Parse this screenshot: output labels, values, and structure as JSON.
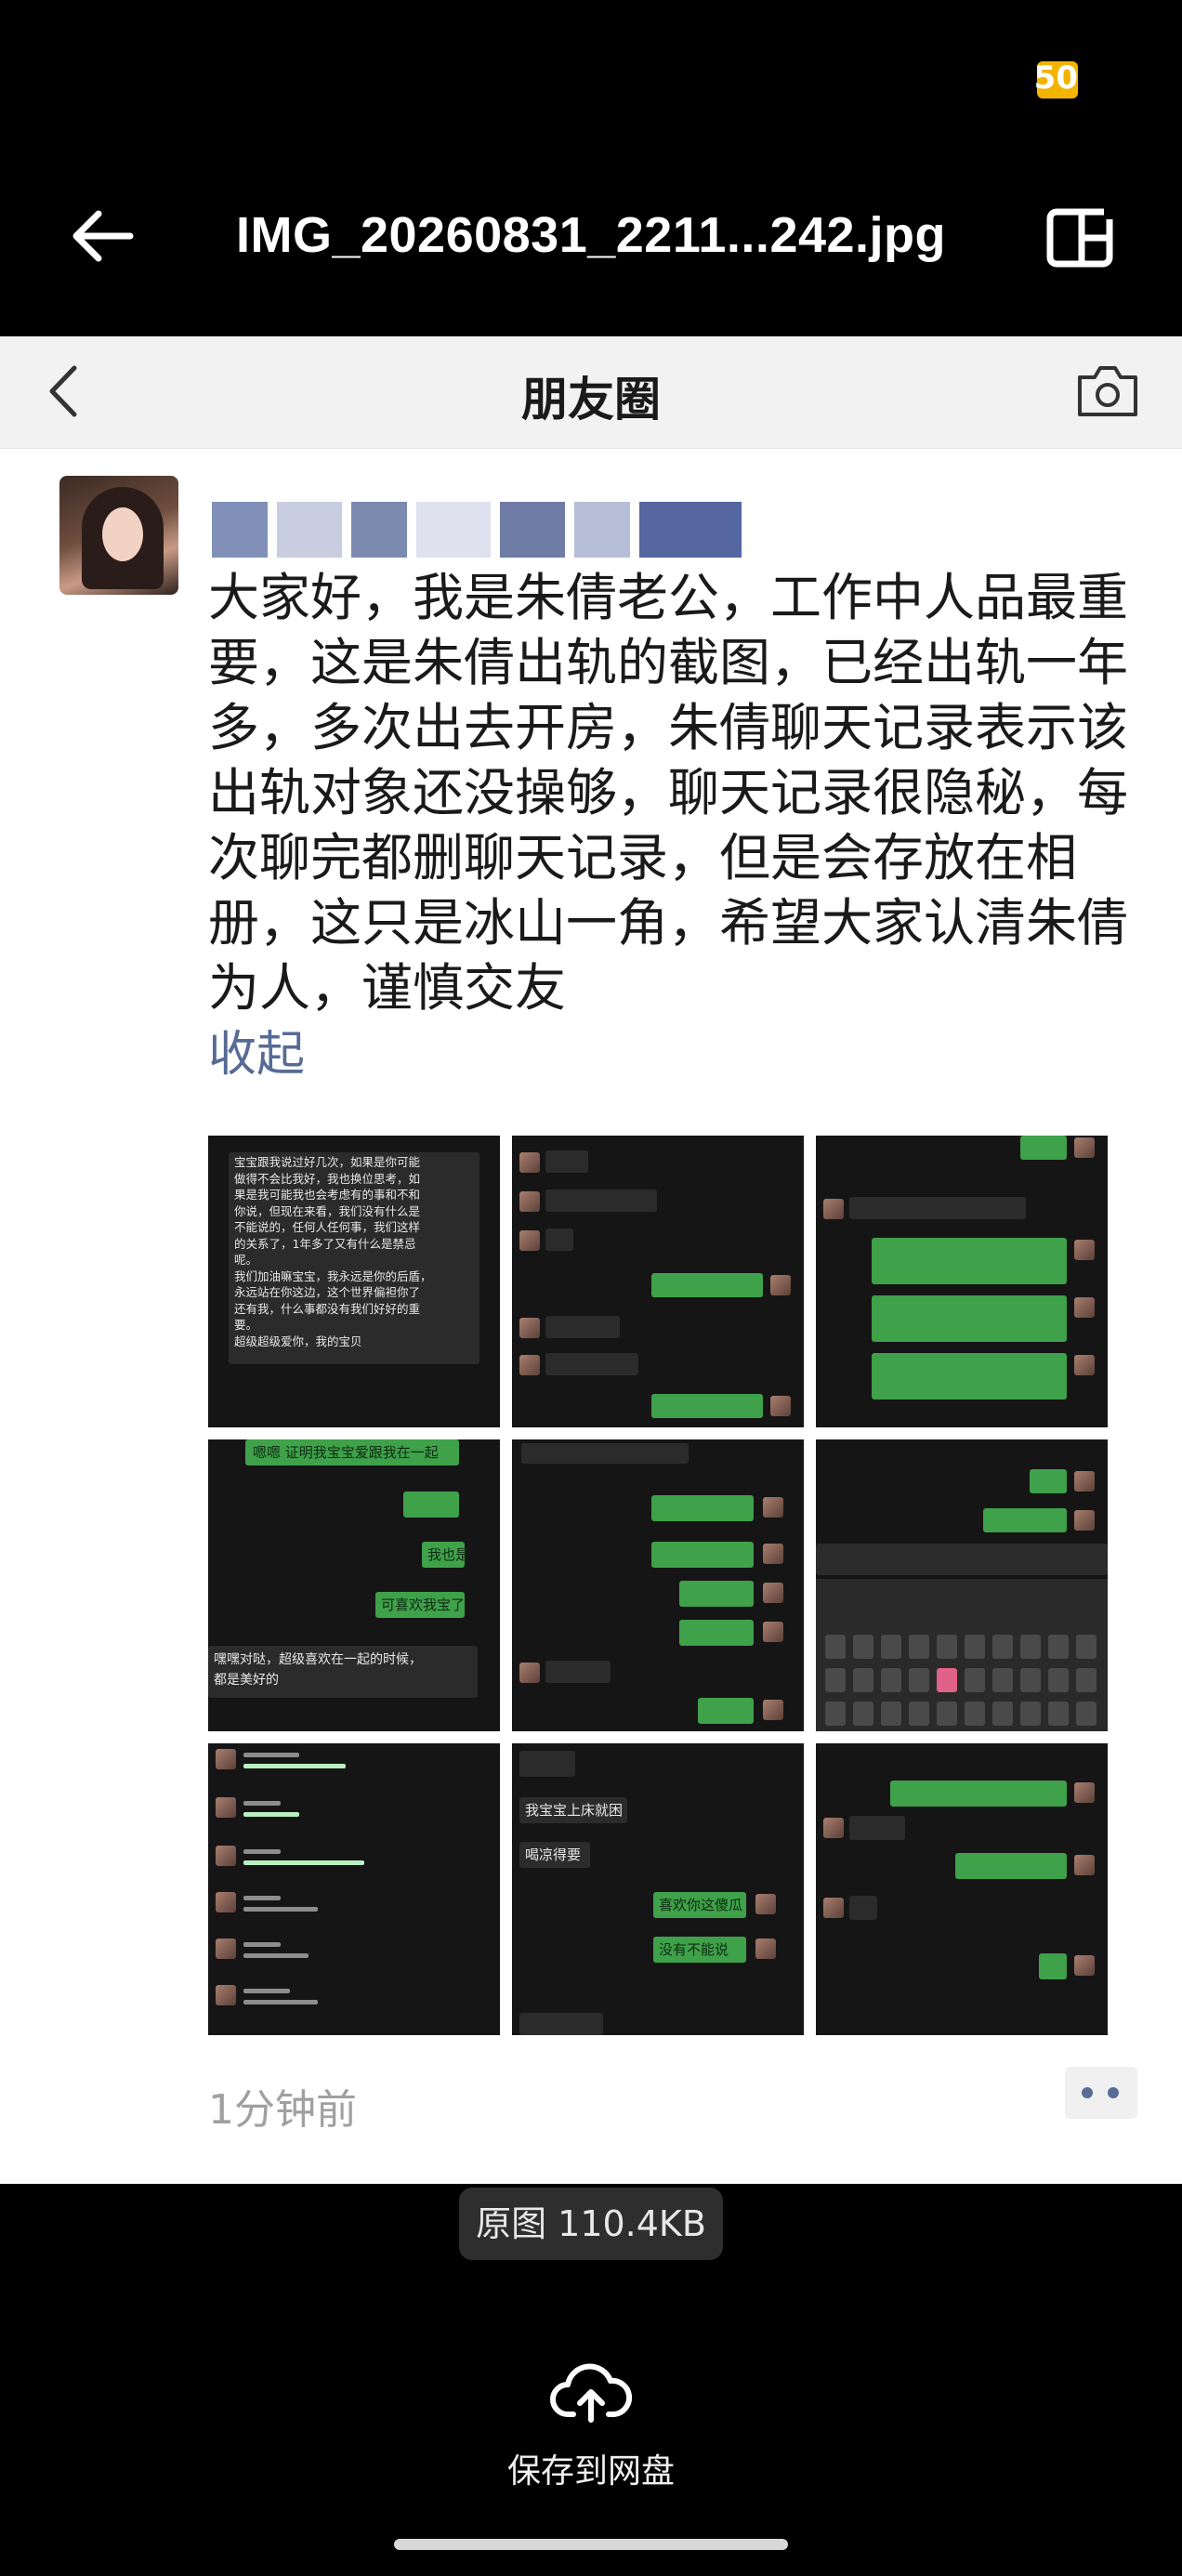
{
  "status_bar": {
    "battery": "50"
  },
  "viewer": {
    "file_name": "IMG_20260831_2211...242.jpg"
  },
  "moments": {
    "title": "朋友圈",
    "post_lines": [
      "大家好，我是朱倩老公，工作中人品最重",
      "要，这是朱倩出轨的截图，已经出轨一年",
      "多，多次出去开房，朱倩聊天记录表示该",
      "出轨对象还没操够，聊天记录很隐秘，每",
      "次聊完都删聊天记录，但是会存放在相",
      "册，这只是冰山一角，希望大家认清朱倩",
      "为人，谨慎交友"
    ],
    "collapse_label": "收起",
    "time_ago": "1分钟前",
    "tile_texts": {
      "t0_lines": [
        "宝宝跟我说过好几次，如果是你可能",
        "做得不会比我好，我也换位思考，如",
        "果是我可能我也会考虑有的事和不和",
        "你说，但现在来看，我们没有什么是",
        "不能说的，任何人任何事，我们这样",
        "的关系了，1年多了又有什么是禁忌",
        "呢。",
        "我们加油嘛宝宝，我永远是你的后盾，",
        "永远站在你这边，这个世界偏袒你了",
        "还有我，什么事都没有我们好好的重",
        "要。",
        "超级超级爱你，我的宝贝"
      ],
      "t3_top": "嗯嗯 证明我宝宝爱跟我在一起",
      "t3_a": "我也是",
      "t3_b": "可喜欢我宝了",
      "t3_bottom": [
        "嘿嘿对哒，超级喜欢在一起的时候，",
        "都是美好的"
      ],
      "t7_a": "我宝宝上床就困",
      "t7_b": "喝凉得要",
      "t7_c": "喜欢你这傻瓜",
      "t7_d": "没有不能说"
    }
  },
  "controls": {
    "original_label": "原图 110.4KB",
    "save_label": "保存到网盘"
  }
}
